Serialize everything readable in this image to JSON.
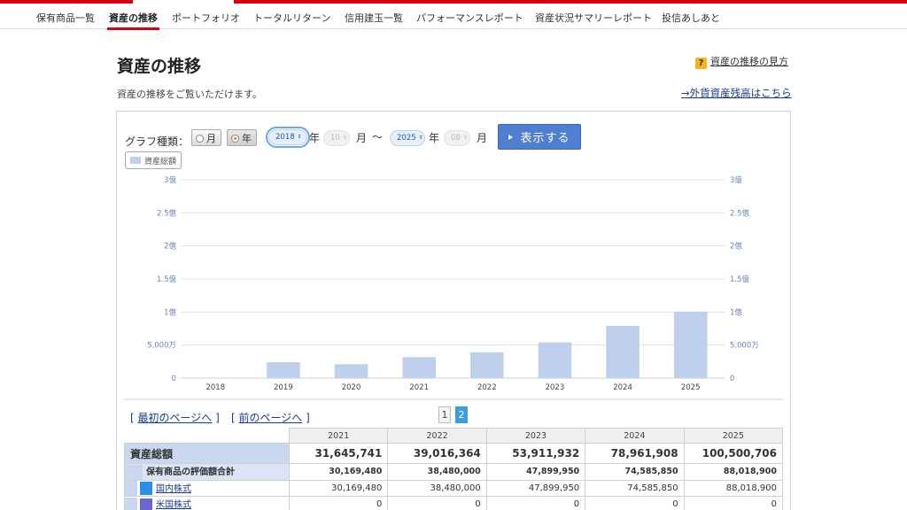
{
  "nav": {
    "items": [
      "保有商品一覧",
      "資産の推移",
      "ポートフォリオ",
      "トータルリターン",
      "信用建玉一覧",
      "パフォーマンスレポート",
      "資産状況サマリーレポート",
      "投信あしあと"
    ],
    "active_index": 1
  },
  "page": {
    "title": "資産の推移",
    "help_link": "資産の推移の見方",
    "help_icon": "question-icon",
    "subtitle": "資産の推移をご覧いただけます。",
    "fx_link": "→外貨資産残高はこちら"
  },
  "controls": {
    "graph_type_label": "グラフ種類：",
    "radio_month": "月",
    "radio_year": "年",
    "selected_type": "年",
    "from_year": "2018",
    "from_year_unit": "年",
    "from_month": "10",
    "from_month_unit": "月",
    "tilde": "〜",
    "to_year": "2025",
    "to_year_unit": "年",
    "to_month": "08",
    "to_month_unit": "月",
    "show_button": "表示する",
    "legend_label": "資産総額"
  },
  "chart_data": {
    "type": "bar",
    "categories": [
      "2018",
      "2019",
      "2020",
      "2021",
      "2022",
      "2023",
      "2024",
      "2025"
    ],
    "series": [
      {
        "name": "資産総額",
        "values": [
          0,
          24000000,
          21000000,
          31645741,
          39016364,
          53911932,
          78961908,
          100500706
        ]
      }
    ],
    "ylim": [
      0,
      300000000
    ],
    "y_ticks": [
      0,
      50000000,
      100000000,
      150000000,
      200000000,
      250000000,
      300000000
    ],
    "y_tick_labels": [
      "0",
      "5,000万",
      "1億",
      "1.5億",
      "2億",
      "2.5億",
      "3億"
    ],
    "y_axis_sides": [
      "left",
      "right"
    ],
    "grid": true,
    "colors": {
      "bar": "#bfd0ec",
      "grid": "#e1e1e1",
      "tick_text": "#6a86b8"
    }
  },
  "pager": {
    "first": "最初のページへ",
    "prev": "前のページへ",
    "pages": [
      "1",
      "2"
    ],
    "current": "2"
  },
  "table": {
    "years": [
      "2021",
      "2022",
      "2023",
      "2024",
      "2025"
    ],
    "rows": [
      {
        "label": "資産総額",
        "level": 0,
        "values": [
          "31,645,741",
          "39,016,364",
          "53,911,932",
          "78,961,908",
          "100,500,706"
        ]
      },
      {
        "label": "保有商品の評価額合計",
        "level": 1,
        "values": [
          "30,169,480",
          "38,480,000",
          "47,899,950",
          "74,585,850",
          "88,018,900"
        ]
      },
      {
        "label": "国内株式",
        "level": 2,
        "color": "#2a8fe6",
        "values": [
          "30,169,480",
          "38,480,000",
          "47,899,950",
          "74,585,850",
          "88,018,900"
        ]
      },
      {
        "label": "米国株式",
        "level": 2,
        "color": "#6b67cf",
        "values": [
          "0",
          "0",
          "0",
          "0",
          "0"
        ]
      }
    ]
  },
  "colors": {
    "brand_red": "#d7000f",
    "link": "#1a3c8c",
    "button_blue": "#4e7fd0"
  }
}
